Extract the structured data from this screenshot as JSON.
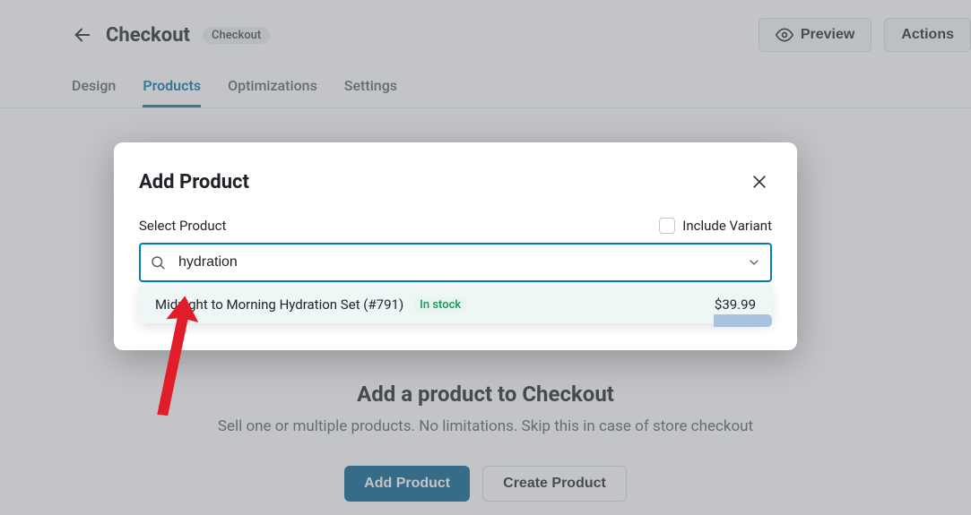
{
  "header": {
    "title": "Checkout",
    "badge": "Checkout",
    "preview": "Preview",
    "actions": "Actions"
  },
  "tabs": {
    "design": "Design",
    "products": "Products",
    "optimizations": "Optimizations",
    "settings": "Settings"
  },
  "content": {
    "heading": "Add a product to Checkout",
    "subheading": "Sell one or multiple products. No limitations. Skip this in case of store checkout",
    "add_btn": "Add Product",
    "create_btn": "Create Product"
  },
  "modal": {
    "title": "Add Product",
    "select_label": "Select Product",
    "include_variant": "Include Variant",
    "search_value": "hydration",
    "option": {
      "name": "Midnight to Morning Hydration Set (#791)",
      "stock": "In stock",
      "price": "$39.99"
    }
  }
}
